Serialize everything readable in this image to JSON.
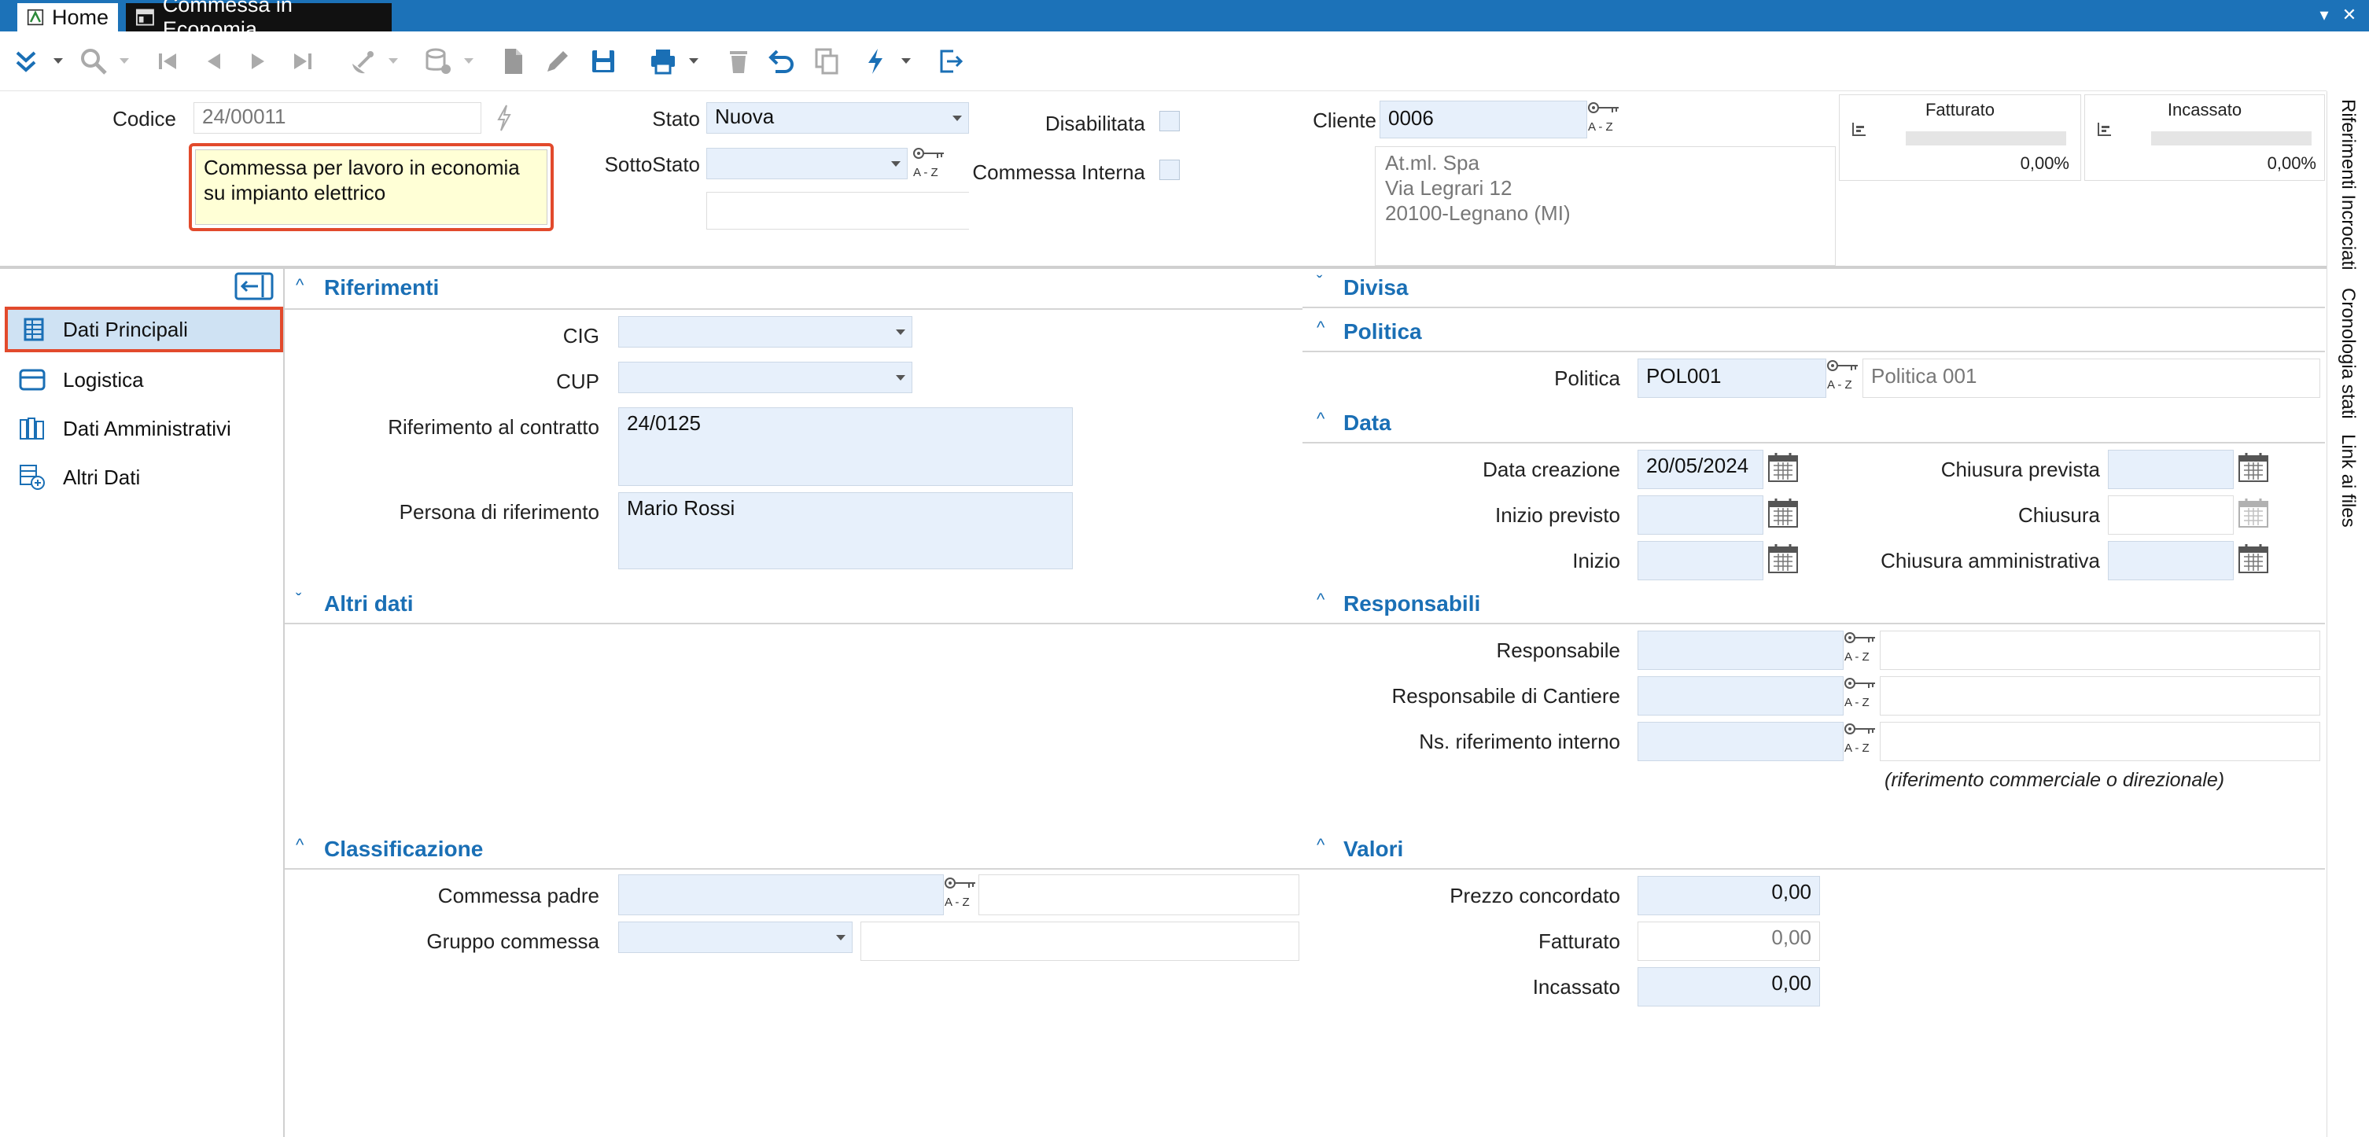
{
  "titlebar": {
    "tabs": [
      {
        "label": "Home"
      },
      {
        "label": "Commessa in Economia"
      }
    ]
  },
  "header": {
    "codice_label": "Codice",
    "codice_value": "24/00011",
    "descrizione": "Commessa per lavoro in economia su impianto elettrico",
    "stato_label": "Stato",
    "stato_value": "Nuova",
    "sottostato_label": "SottoStato",
    "sottostato_value": "",
    "disabilitata_label": "Disabilitata",
    "commessa_interna_label": "Commessa Interna",
    "cliente_label": "Cliente",
    "cliente_value": "0006",
    "cliente_address": [
      "At.ml. Spa",
      "Via Legrari 12",
      "20100-Legnano (MI)"
    ],
    "fatturato": {
      "label": "Fatturato",
      "value": "0,00%",
      "fraction": 0
    },
    "incassato": {
      "label": "Incassato",
      "value": "0,00%",
      "fraction": 0
    }
  },
  "sidebar": {
    "items": [
      {
        "label": "Dati Principali",
        "icon": "table-grid-icon",
        "active": true
      },
      {
        "label": "Logistica",
        "icon": "card-icon"
      },
      {
        "label": "Dati Amministrativi",
        "icon": "books-icon"
      },
      {
        "label": "Altri Dati",
        "icon": "add-table-icon"
      }
    ]
  },
  "sections": {
    "riferimenti": {
      "title": "Riferimenti",
      "cig_label": "CIG",
      "cig_value": "",
      "cup_label": "CUP",
      "cup_value": "",
      "rif_contratto_label": "Riferimento al contratto",
      "rif_contratto_value": "24/0125",
      "persona_label": "Persona di riferimento",
      "persona_value": "Mario Rossi"
    },
    "altri_dati": {
      "title": "Altri dati"
    },
    "classificazione": {
      "title": "Classificazione",
      "padre_label": "Commessa padre",
      "gruppo_label": "Gruppo commessa"
    },
    "divisa": {
      "title": "Divisa"
    },
    "politica": {
      "title": "Politica",
      "politica_label": "Politica",
      "politica_code": "POL001",
      "politica_desc": "Politica 001"
    },
    "data": {
      "title": "Data",
      "creazione_label": "Data creazione",
      "creazione_value": "20/05/2024",
      "inizio_previsto_label": "Inizio previsto",
      "inizio_label": "Inizio",
      "chiusura_prevista_label": "Chiusura prevista",
      "chiusura_label": "Chiusura",
      "chiusura_amm_label": "Chiusura amministrativa"
    },
    "responsabili": {
      "title": "Responsabili",
      "responsabile_label": "Responsabile",
      "resp_cantiere_label": "Responsabile di Cantiere",
      "ns_rif_label": "Ns. riferimento interno",
      "note": "(riferimento commerciale o direzionale)"
    },
    "valori": {
      "title": "Valori",
      "prezzo_label": "Prezzo concordato",
      "prezzo_value": "0,00",
      "fatturato_label": "Fatturato",
      "fatturato_value": "0,00",
      "incassato_label": "Incassato",
      "incassato_value": "0,00"
    }
  },
  "rightbar": {
    "tabs": [
      "Riferimenti Incrociati",
      "Cronologia stati",
      "Link ai files"
    ]
  },
  "keyaz_text": "A - Z"
}
